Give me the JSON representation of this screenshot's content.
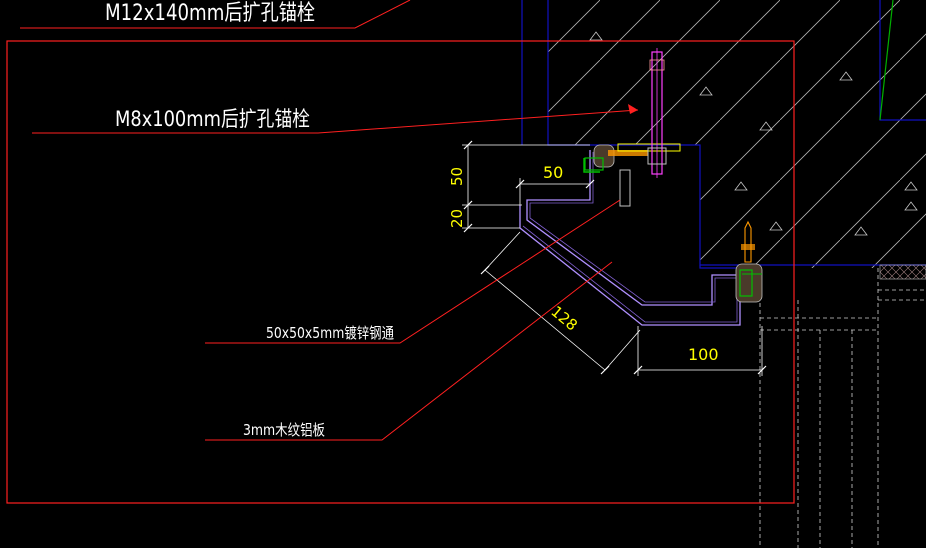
{
  "colors": {
    "background": "#000000",
    "leader_red": "#ff2020",
    "dimension_yellow": "#ffff00",
    "structure_blue": "#1010c0",
    "hatch_white": "#c8c8c8",
    "panel_violet": "#b090ff",
    "anchor_magenta": "#ff40ff",
    "seal_green": "#00c000",
    "connector_orange": "#ff9900",
    "text_white": "#ffffff"
  },
  "labels": {
    "anchor_m12": "M12x140mm后扩孔锚栓",
    "anchor_m8": "M8x100mm后扩孔锚栓",
    "angle_steel": "50x50x5mm镀锌钢通",
    "aluminum_panel": "3mm木纹铝板"
  },
  "dimensions": {
    "d50_vertical": "50",
    "d20_vertical": "20",
    "d50_horizontal": "50",
    "d128_diagonal": "128",
    "d100_horizontal": "100"
  }
}
